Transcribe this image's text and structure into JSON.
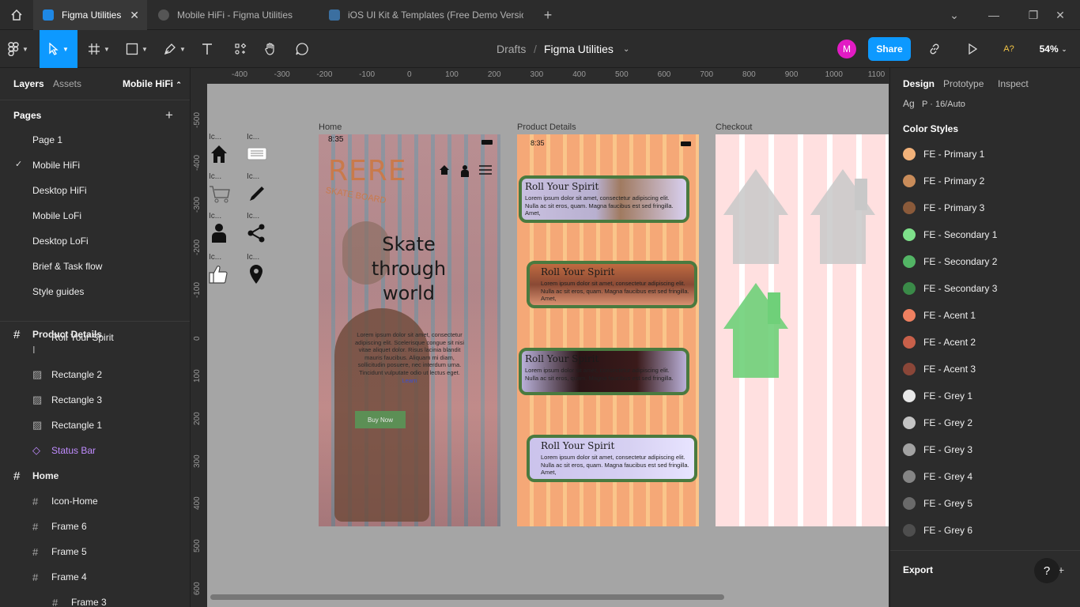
{
  "tabs": [
    {
      "label": "Figma Utilities",
      "active": true
    },
    {
      "label": "Mobile HiFi - Figma Utilities",
      "active": false
    },
    {
      "label": "iOS UI Kit & Templates (Free Demo Version",
      "active": false
    }
  ],
  "toolbar": {
    "breadcrumb_parent": "Drafts",
    "breadcrumb_sep": "/",
    "file_name": "Figma Utilities",
    "avatar_letter": "M",
    "share_label": "Share",
    "accessibility_label": "A?",
    "zoom": "54%"
  },
  "left_panel": {
    "tab_layers": "Layers",
    "tab_assets": "Assets",
    "page_selector": "Mobile HiFi",
    "pages_title": "Pages",
    "pages": [
      "Page 1",
      "Mobile HiFi",
      "Desktop HiFi",
      "Mobile LoFi",
      "Desktop LoFi",
      "Brief & Task flow",
      "Style guides"
    ],
    "current_page": "Mobile HiFi",
    "layers": [
      {
        "name": "Product Details",
        "type": "frame",
        "level": 0
      },
      {
        "name": "Roll Your Spirit",
        "type": "text",
        "level": 1
      },
      {
        "name": "Rectangle 2",
        "type": "image",
        "level": 1
      },
      {
        "name": "Rectangle 3",
        "type": "image",
        "level": 1
      },
      {
        "name": "Rectangle 1",
        "type": "image",
        "level": 1
      },
      {
        "name": "Status Bar",
        "type": "component",
        "level": 1
      },
      {
        "name": "Home",
        "type": "frame",
        "level": 0
      },
      {
        "name": "Icon-Home",
        "type": "frame",
        "level": 1
      },
      {
        "name": "Frame 6",
        "type": "frame",
        "level": 1
      },
      {
        "name": "Frame 5",
        "type": "frame",
        "level": 1
      },
      {
        "name": "Frame 4",
        "type": "frame",
        "level": 1
      },
      {
        "name": "Frame 3",
        "type": "frame",
        "level": 2
      }
    ]
  },
  "rulers": {
    "top": [
      "-400",
      "-300",
      "-200",
      "-100",
      "0",
      "100",
      "200",
      "300",
      "400",
      "500",
      "600",
      "700",
      "800",
      "900",
      "1000",
      "1100"
    ],
    "left": [
      "-500",
      "-400",
      "-300",
      "-200",
      "-100",
      "0",
      "100",
      "200",
      "300",
      "400",
      "500",
      "600"
    ]
  },
  "canvas": {
    "icon_label": "Ic...",
    "frames": {
      "home": {
        "label": "Home",
        "time": "8:35",
        "brand": "RERE",
        "brand_sub": "SKATE BOARD",
        "headline_1": "Skate",
        "headline_2": "through",
        "headline_3": "world",
        "body": "Lorem ipsum dolor sit amet, consectetur adipiscing elit. Scelerisque congue sit nisi vitae aliquet dolor. Risus lacinia blandit mauris faucibus. Aliquam mi diam, sollicitudin posuere, nec interdum urna. Tincidunt vulputate odio ut lectus eget.",
        "link": "Learn",
        "cta": "Buy Now"
      },
      "product": {
        "label": "Product Details",
        "time": "8:35",
        "cards": [
          {
            "title": "Roll Your Spirit",
            "body": "Lorem ipsum dolor sit amet, consectetur adipiscing elit. Nulla ac sit eros, quam. Magna faucibus est sed fringilla. Amet,"
          },
          {
            "title": "Roll Your Spirit",
            "body": "Lorem ipsum dolor sit amet, consectetur adipiscing elit. Nulla ac sit eros, quam. Magna faucibus est sed fringilla. Amet,"
          },
          {
            "title": "Roll Your Spirit",
            "body": "Lorem ipsum dolor sit amet, consectetur adipiscing elit. Nulla ac sit eros, quam. Magna faucibus est sed fringilla."
          },
          {
            "title": "Roll Your Spirit",
            "body": "Lorem ipsum dolor sit amet, consectetur adipiscing elit. Nulla ac sit eros, quam. Magna faucibus est sed fringilla. Amet,"
          }
        ]
      },
      "checkout": {
        "label": "Checkout"
      }
    }
  },
  "right_panel": {
    "tabs": [
      "Design",
      "Prototype",
      "Inspect"
    ],
    "active_tab": "Design",
    "text_style_prefix": "Ag",
    "text_style": "P · 16/Auto",
    "color_styles_title": "Color Styles",
    "color_styles": [
      {
        "name": "FE - Primary 1",
        "color": "#f2b27a"
      },
      {
        "name": "FE - Primary 2",
        "color": "#c98c5a"
      },
      {
        "name": "FE - Primary 3",
        "color": "#8a5a3a"
      },
      {
        "name": "FE - Secondary 1",
        "color": "#7ee08a"
      },
      {
        "name": "FE - Secondary 2",
        "color": "#53b565"
      },
      {
        "name": "FE - Secondary 3",
        "color": "#3a8a48"
      },
      {
        "name": "FE - Acent 1",
        "color": "#ef8060"
      },
      {
        "name": "FE - Acent 2",
        "color": "#c8604a"
      },
      {
        "name": "FE - Acent 3",
        "color": "#8a4638"
      },
      {
        "name": "FE - Grey 1",
        "color": "#e8e8e8"
      },
      {
        "name": "FE - Grey 2",
        "color": "#c4c4c4"
      },
      {
        "name": "FE - Grey 3",
        "color": "#a2a2a2"
      },
      {
        "name": "FE - Grey 4",
        "color": "#858585"
      },
      {
        "name": "FE - Grey 5",
        "color": "#6a6a6a"
      },
      {
        "name": "FE - Grey 6",
        "color": "#4e4e4e"
      }
    ],
    "export_label": "Export",
    "help_label": "?"
  },
  "colors": {
    "accent": "#0d99ff",
    "avatar": "#e21bc4",
    "canvas": "#a5a5a5",
    "product_bg": "#f5a877",
    "card_border": "#4a7a3f",
    "cta_green": "#5c8f55"
  }
}
